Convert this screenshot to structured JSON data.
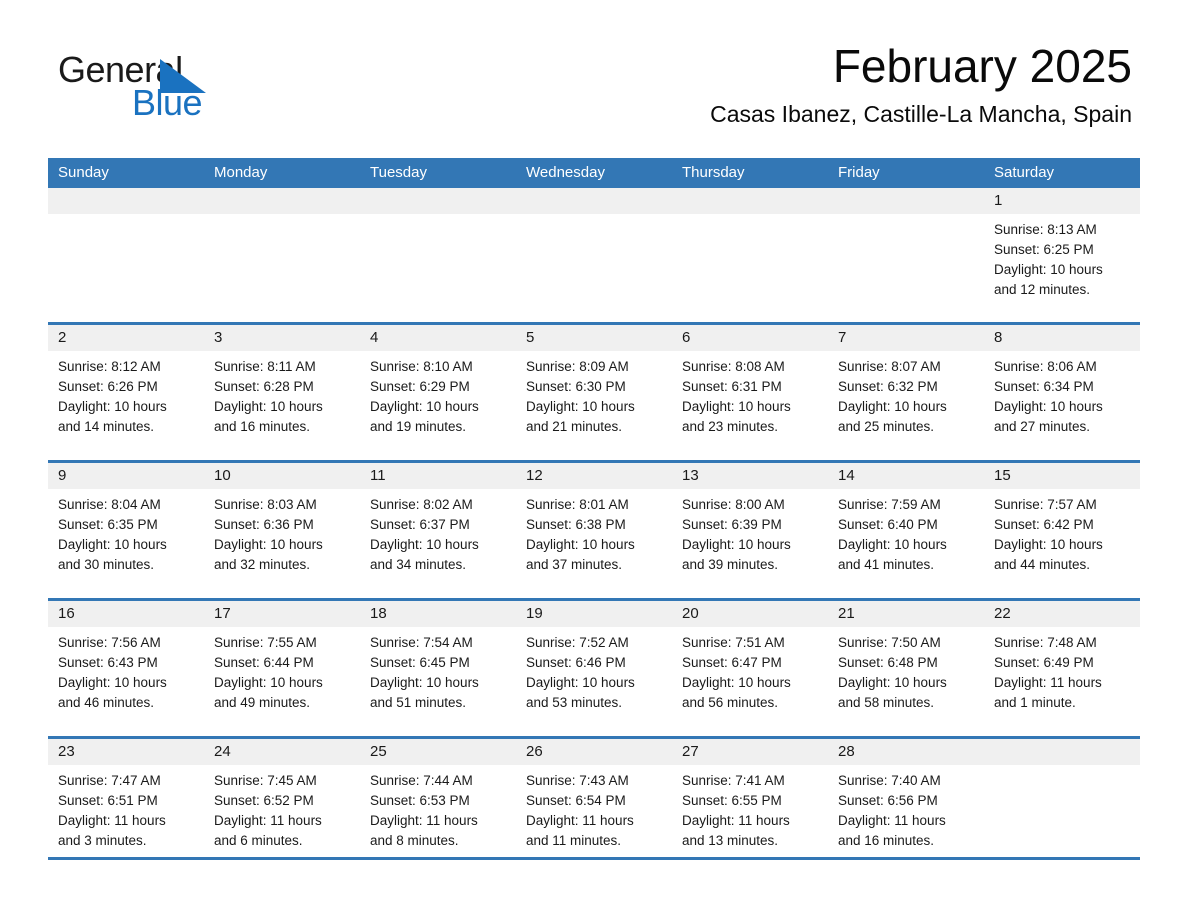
{
  "brand": {
    "name_dark": "General",
    "name_blue": "Blue",
    "triangle_color": "#1a72c0",
    "accent_color": "#3377b5"
  },
  "header": {
    "title": "February 2025",
    "subtitle": "Casas Ibanez, Castille-La Mancha, Spain"
  },
  "calendar": {
    "weekdays": [
      "Sunday",
      "Monday",
      "Tuesday",
      "Wednesday",
      "Thursday",
      "Friday",
      "Saturday"
    ],
    "weeks": [
      [
        {
          "day": "",
          "empty": true
        },
        {
          "day": "",
          "empty": true
        },
        {
          "day": "",
          "empty": true
        },
        {
          "day": "",
          "empty": true
        },
        {
          "day": "",
          "empty": true
        },
        {
          "day": "",
          "empty": true
        },
        {
          "day": "1",
          "sunrise": "Sunrise: 8:13 AM",
          "sunset": "Sunset: 6:25 PM",
          "daylight_1": "Daylight: 10 hours",
          "daylight_2": "and 12 minutes."
        }
      ],
      [
        {
          "day": "2",
          "sunrise": "Sunrise: 8:12 AM",
          "sunset": "Sunset: 6:26 PM",
          "daylight_1": "Daylight: 10 hours",
          "daylight_2": "and 14 minutes."
        },
        {
          "day": "3",
          "sunrise": "Sunrise: 8:11 AM",
          "sunset": "Sunset: 6:28 PM",
          "daylight_1": "Daylight: 10 hours",
          "daylight_2": "and 16 minutes."
        },
        {
          "day": "4",
          "sunrise": "Sunrise: 8:10 AM",
          "sunset": "Sunset: 6:29 PM",
          "daylight_1": "Daylight: 10 hours",
          "daylight_2": "and 19 minutes."
        },
        {
          "day": "5",
          "sunrise": "Sunrise: 8:09 AM",
          "sunset": "Sunset: 6:30 PM",
          "daylight_1": "Daylight: 10 hours",
          "daylight_2": "and 21 minutes."
        },
        {
          "day": "6",
          "sunrise": "Sunrise: 8:08 AM",
          "sunset": "Sunset: 6:31 PM",
          "daylight_1": "Daylight: 10 hours",
          "daylight_2": "and 23 minutes."
        },
        {
          "day": "7",
          "sunrise": "Sunrise: 8:07 AM",
          "sunset": "Sunset: 6:32 PM",
          "daylight_1": "Daylight: 10 hours",
          "daylight_2": "and 25 minutes."
        },
        {
          "day": "8",
          "sunrise": "Sunrise: 8:06 AM",
          "sunset": "Sunset: 6:34 PM",
          "daylight_1": "Daylight: 10 hours",
          "daylight_2": "and 27 minutes."
        }
      ],
      [
        {
          "day": "9",
          "sunrise": "Sunrise: 8:04 AM",
          "sunset": "Sunset: 6:35 PM",
          "daylight_1": "Daylight: 10 hours",
          "daylight_2": "and 30 minutes."
        },
        {
          "day": "10",
          "sunrise": "Sunrise: 8:03 AM",
          "sunset": "Sunset: 6:36 PM",
          "daylight_1": "Daylight: 10 hours",
          "daylight_2": "and 32 minutes."
        },
        {
          "day": "11",
          "sunrise": "Sunrise: 8:02 AM",
          "sunset": "Sunset: 6:37 PM",
          "daylight_1": "Daylight: 10 hours",
          "daylight_2": "and 34 minutes."
        },
        {
          "day": "12",
          "sunrise": "Sunrise: 8:01 AM",
          "sunset": "Sunset: 6:38 PM",
          "daylight_1": "Daylight: 10 hours",
          "daylight_2": "and 37 minutes."
        },
        {
          "day": "13",
          "sunrise": "Sunrise: 8:00 AM",
          "sunset": "Sunset: 6:39 PM",
          "daylight_1": "Daylight: 10 hours",
          "daylight_2": "and 39 minutes."
        },
        {
          "day": "14",
          "sunrise": "Sunrise: 7:59 AM",
          "sunset": "Sunset: 6:40 PM",
          "daylight_1": "Daylight: 10 hours",
          "daylight_2": "and 41 minutes."
        },
        {
          "day": "15",
          "sunrise": "Sunrise: 7:57 AM",
          "sunset": "Sunset: 6:42 PM",
          "daylight_1": "Daylight: 10 hours",
          "daylight_2": "and 44 minutes."
        }
      ],
      [
        {
          "day": "16",
          "sunrise": "Sunrise: 7:56 AM",
          "sunset": "Sunset: 6:43 PM",
          "daylight_1": "Daylight: 10 hours",
          "daylight_2": "and 46 minutes."
        },
        {
          "day": "17",
          "sunrise": "Sunrise: 7:55 AM",
          "sunset": "Sunset: 6:44 PM",
          "daylight_1": "Daylight: 10 hours",
          "daylight_2": "and 49 minutes."
        },
        {
          "day": "18",
          "sunrise": "Sunrise: 7:54 AM",
          "sunset": "Sunset: 6:45 PM",
          "daylight_1": "Daylight: 10 hours",
          "daylight_2": "and 51 minutes."
        },
        {
          "day": "19",
          "sunrise": "Sunrise: 7:52 AM",
          "sunset": "Sunset: 6:46 PM",
          "daylight_1": "Daylight: 10 hours",
          "daylight_2": "and 53 minutes."
        },
        {
          "day": "20",
          "sunrise": "Sunrise: 7:51 AM",
          "sunset": "Sunset: 6:47 PM",
          "daylight_1": "Daylight: 10 hours",
          "daylight_2": "and 56 minutes."
        },
        {
          "day": "21",
          "sunrise": "Sunrise: 7:50 AM",
          "sunset": "Sunset: 6:48 PM",
          "daylight_1": "Daylight: 10 hours",
          "daylight_2": "and 58 minutes."
        },
        {
          "day": "22",
          "sunrise": "Sunrise: 7:48 AM",
          "sunset": "Sunset: 6:49 PM",
          "daylight_1": "Daylight: 11 hours",
          "daylight_2": "and 1 minute."
        }
      ],
      [
        {
          "day": "23",
          "sunrise": "Sunrise: 7:47 AM",
          "sunset": "Sunset: 6:51 PM",
          "daylight_1": "Daylight: 11 hours",
          "daylight_2": "and 3 minutes."
        },
        {
          "day": "24",
          "sunrise": "Sunrise: 7:45 AM",
          "sunset": "Sunset: 6:52 PM",
          "daylight_1": "Daylight: 11 hours",
          "daylight_2": "and 6 minutes."
        },
        {
          "day": "25",
          "sunrise": "Sunrise: 7:44 AM",
          "sunset": "Sunset: 6:53 PM",
          "daylight_1": "Daylight: 11 hours",
          "daylight_2": "and 8 minutes."
        },
        {
          "day": "26",
          "sunrise": "Sunrise: 7:43 AM",
          "sunset": "Sunset: 6:54 PM",
          "daylight_1": "Daylight: 11 hours",
          "daylight_2": "and 11 minutes."
        },
        {
          "day": "27",
          "sunrise": "Sunrise: 7:41 AM",
          "sunset": "Sunset: 6:55 PM",
          "daylight_1": "Daylight: 11 hours",
          "daylight_2": "and 13 minutes."
        },
        {
          "day": "28",
          "sunrise": "Sunrise: 7:40 AM",
          "sunset": "Sunset: 6:56 PM",
          "daylight_1": "Daylight: 11 hours",
          "daylight_2": "and 16 minutes."
        },
        {
          "day": "",
          "empty": true
        }
      ]
    ]
  }
}
